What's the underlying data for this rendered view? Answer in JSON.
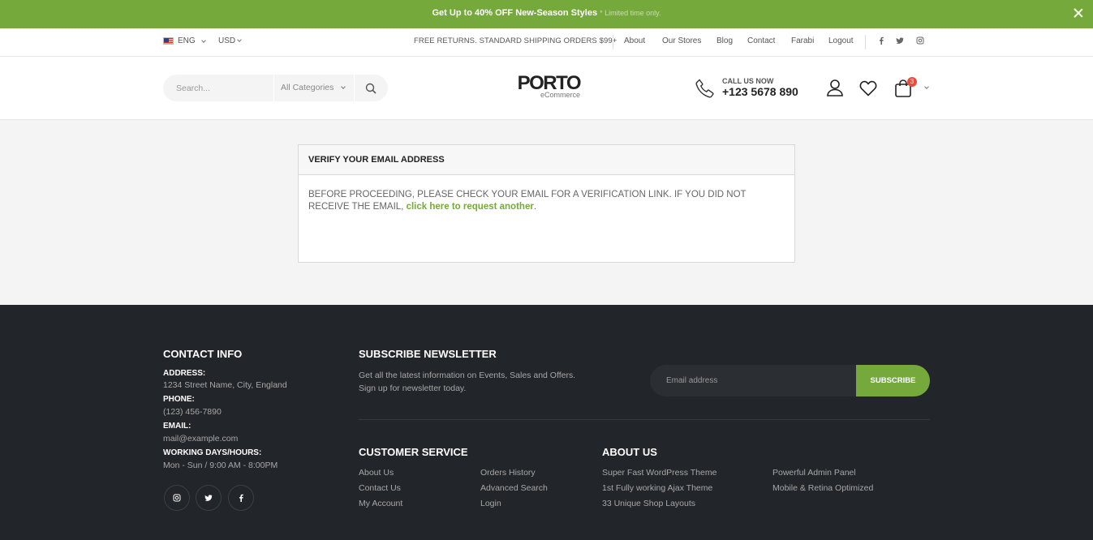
{
  "promo": {
    "text": "Get Up to",
    "highlight": "40% OFF",
    "rest": "New-Season Styles",
    "note": "* Limited time only."
  },
  "topbar": {
    "language": "ENG",
    "currency": "USD",
    "shipping": "FREE RETURNS. STANDARD SHIPPING ORDERS $99+",
    "nav": [
      "About",
      "Our Stores",
      "Blog",
      "Contact",
      "Farabi",
      "Logout"
    ],
    "social_labels": [
      "f",
      "t",
      "ig"
    ]
  },
  "header": {
    "search_placeholder": "Search...",
    "category": "All Categories",
    "logo_main": "PORTO",
    "logo_sub": "eCommerce",
    "call_label": "CALL US NOW",
    "phone": "+123 5678 890",
    "cart_count": "3"
  },
  "verify": {
    "title": "VERIFY YOUR EMAIL ADDRESS",
    "message": "BEFORE PROCEEDING, PLEASE CHECK YOUR EMAIL FOR A VERIFICATION LINK. IF YOU DID NOT RECEIVE THE EMAIL,",
    "link": "click here to request another",
    "end": "."
  },
  "footer": {
    "contact_title": "CONTACT INFO",
    "address_label": "ADDRESS:",
    "address": "1234 Street Name, City, England",
    "phone_label": "PHONE:",
    "phone": "(123) 456-7890",
    "email_label": "EMAIL:",
    "email": "mail@example.com",
    "hours_label": "WORKING DAYS/HOURS:",
    "hours": "Mon - Sun / 9:00 AM - 8:00PM",
    "newsletter_title": "SUBSCRIBE NEWSLETTER",
    "newsletter_line1": "Get all the latest information on Events, Sales and Offers.",
    "newsletter_line2": "Sign up for newsletter today.",
    "email_placeholder": "Email address",
    "subscribe": "SUBSCRIBE",
    "customer_title": "CUSTOMER SERVICE",
    "customer_col1": [
      "About Us",
      "Contact Us",
      "My Account"
    ],
    "customer_col2": [
      "Orders History",
      "Advanced Search",
      "Login"
    ],
    "about_title": "ABOUT US",
    "about_col1": [
      "Super Fast WordPress Theme",
      "1st Fully working Ajax Theme",
      "33 Unique Shop Layouts"
    ],
    "about_col2": [
      "Powerful Admin Panel",
      "Mobile & Retina Optimized"
    ]
  },
  "colors": {
    "accent": "#76a93b",
    "footer_bg": "#222529",
    "badge": "#e84c3d"
  }
}
